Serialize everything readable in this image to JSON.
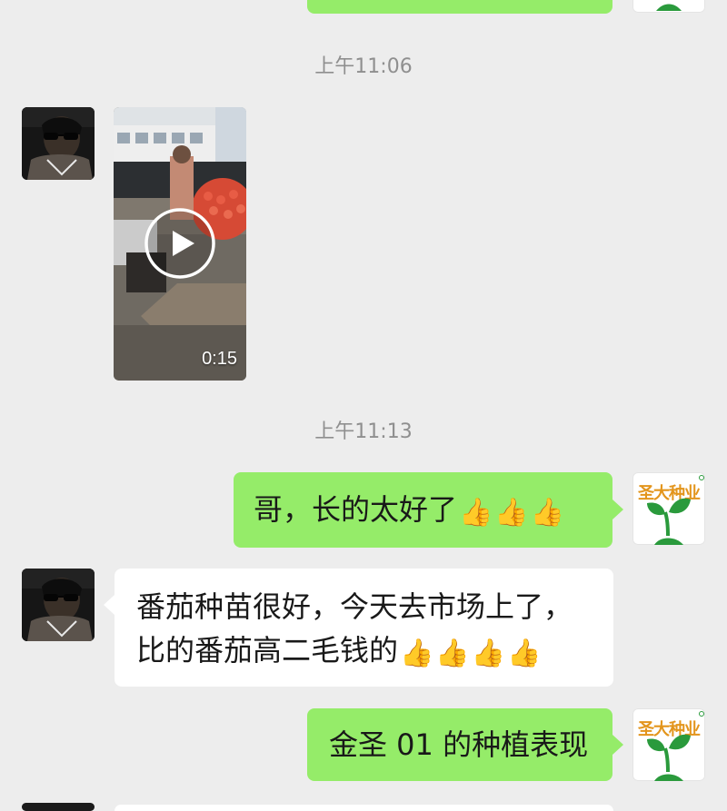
{
  "timestamps": [
    "上午11:06",
    "上午11:13"
  ],
  "brand": {
    "name": "圣大种业",
    "color": "#e3951c",
    "icon": "seedling-logo-icon"
  },
  "video": {
    "duration": "0:15",
    "icon": "play-icon"
  },
  "messages": [
    {
      "side": "right",
      "sender": "brand",
      "text": "哥，长的太好了",
      "thumbs": 3
    },
    {
      "side": "left",
      "sender": "user",
      "lines": [
        "番茄种苗很好，今天去市场上了，",
        "比的番茄高二毛钱的"
      ],
      "thumbs": 4
    },
    {
      "side": "right",
      "sender": "brand",
      "text": "金圣 01 的种植表现",
      "thumbs": 0
    }
  ],
  "thumb_glyph": "👍",
  "colors": {
    "background": "#ededed",
    "bubble_out": "#95ec69",
    "bubble_in": "#ffffff",
    "timestamp": "#8f8f8f",
    "brand_green": "#2a9a3c"
  }
}
